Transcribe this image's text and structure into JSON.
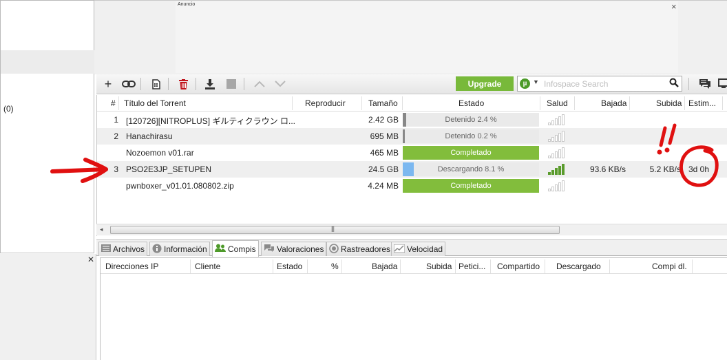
{
  "sidebar": {
    "count_label": "(0)"
  },
  "ad": {
    "label": "Anuncio",
    "close": "×"
  },
  "toolbar": {
    "upgrade_label": "Upgrade",
    "search_placeholder": "Infospace Search",
    "search_logo": "µ"
  },
  "torrents": {
    "headers": [
      "#",
      "Título del Torrent",
      "Reproducir",
      "Tamaño",
      "Estado",
      "Salud",
      "Bajada",
      "Subida",
      "Estim..."
    ],
    "rows": [
      {
        "num": "1",
        "title": "[120726][NITROPLUS] ギルティクラウン ロ...",
        "size": "2.42 GB",
        "status": "Detenido 2.4 %",
        "progress": 2.4,
        "state": "stopped",
        "health": 0,
        "down": "",
        "up": "",
        "eta": ""
      },
      {
        "num": "2",
        "title": "Hanachirasu",
        "size": "695 MB",
        "status": "Detenido 0.2 %",
        "progress": 0.2,
        "state": "stopped",
        "health": 0,
        "down": "",
        "up": "",
        "eta": ""
      },
      {
        "num": "",
        "title": "Nozoemon v01.rar",
        "size": "465 MB",
        "status": "Completado",
        "progress": 100,
        "state": "done",
        "health": 0,
        "down": "",
        "up": "",
        "eta": ""
      },
      {
        "num": "3",
        "title": "PSO2E3JP_SETUPEN",
        "size": "24.5 GB",
        "status": "Descargando 8.1 %",
        "progress": 8.1,
        "state": "downloading",
        "health": 5,
        "down": "93.6 KB/s",
        "up": "5.2 KB/s",
        "eta": "3d 0h"
      },
      {
        "num": "",
        "title": "pwnboxer_v01.01.080802.zip",
        "size": "4.24 MB",
        "status": "Completado",
        "progress": 100,
        "state": "done",
        "health": 0,
        "down": "",
        "up": "",
        "eta": ""
      }
    ]
  },
  "tabs": [
    {
      "label": "Archivos",
      "icon": "files-icon",
      "active": false
    },
    {
      "label": "Información",
      "icon": "info-icon",
      "active": false
    },
    {
      "label": "Compis",
      "icon": "peers-icon",
      "active": true
    },
    {
      "label": "Valoraciones",
      "icon": "ratings-icon",
      "active": false
    },
    {
      "label": "Rastreadores",
      "icon": "trackers-icon",
      "active": false
    },
    {
      "label": "Velocidad",
      "icon": "speed-icon",
      "active": false
    }
  ],
  "peers": {
    "headers": [
      "Direcciones IP",
      "Cliente",
      "Estado",
      "%",
      "Bajada",
      "Subida",
      "Petici...",
      "Compartido",
      "Descargado",
      "Compi dl."
    ]
  },
  "colors": {
    "complete_green": "#82bd3c",
    "progress_blue": "#7cb8f0",
    "stopped_gray": "#888888",
    "health_green": "#5a9b2c",
    "annotation_red": "#e01010"
  }
}
